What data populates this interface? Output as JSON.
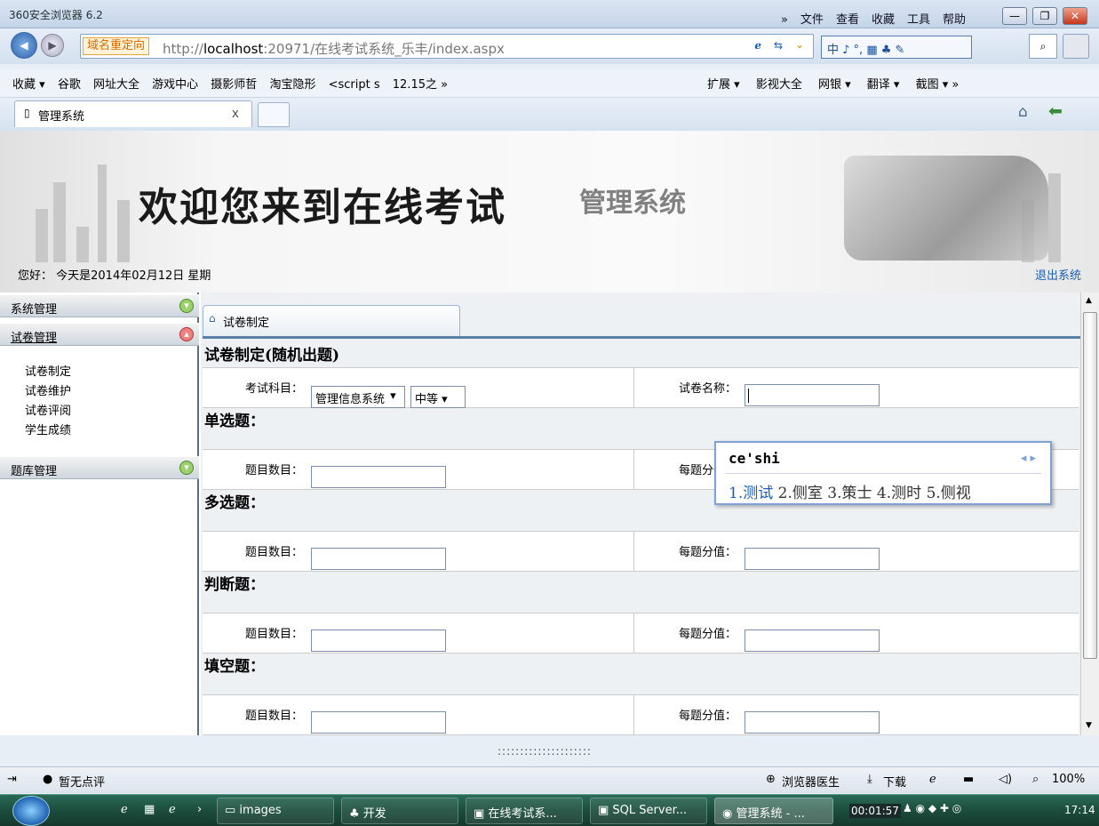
{
  "browser": {
    "title": "360安全浏览器 6.2",
    "menu": [
      "»",
      "文件",
      "查看",
      "收藏",
      "工具",
      "帮助"
    ],
    "redirect_label": "域名重定向",
    "url_prefix": "http://",
    "url_host": "localhost",
    "url_rest": ":20971/在线考试系统_乐丰/index.aspx",
    "ime_bar_text": "中 ♪ °, ▦ ♣ ✎",
    "favorites": [
      "收藏 ▾",
      "谷歌",
      "网址大全",
      "游戏中心",
      "摄影师哲",
      "淘宝隐形",
      "<script s",
      "12.15之 »"
    ],
    "right_tools": [
      "扩展 ▾",
      "影视大全",
      "网银 ▾",
      "翻译 ▾",
      "截图 ▾ »"
    ],
    "tab_title": "管理系统",
    "tab_close": "x"
  },
  "banner": {
    "welcome": "欢迎您来到在线考试",
    "subtitle": "管理系统",
    "greeting": "您好：   今天是2014年02月12日   星期",
    "logout": "退出系统"
  },
  "sidebar": {
    "groups": [
      {
        "label": "系统管理"
      },
      {
        "label": "试卷管理"
      },
      {
        "label": "题库管理"
      }
    ],
    "items": [
      "试卷制定",
      "试卷维护",
      "试卷评阅",
      "学生成绩"
    ]
  },
  "main": {
    "tab_label": "试卷制定",
    "form_title": "试卷制定(随机出题)",
    "subject_label": "考试科目：",
    "subject_value": "管理信息系统",
    "level_value": "中等",
    "paper_name_label": "试卷名称：",
    "paper_name_value": "",
    "sections": [
      {
        "title": "单选题：",
        "count_label": "题目数目：",
        "score_label": "每题分值："
      },
      {
        "title": "多选题：",
        "count_label": "题目数目：",
        "score_label": "每题分值："
      },
      {
        "title": "判断题：",
        "count_label": "题目数目：",
        "score_label": "每题分值："
      },
      {
        "title": "填空题：",
        "count_label": "题目数目：",
        "score_label": "每题分值："
      }
    ]
  },
  "ime_popup": {
    "composition": "ce'shi",
    "arrows": "◂ ▸",
    "candidates": [
      "1.测试",
      "2.侧室",
      "3.策士",
      "4.测时",
      "5.侧视"
    ]
  },
  "status": {
    "dots": ":::::::::::::::::::::",
    "rating": "暂无点评",
    "doctor": "浏览器医生",
    "download": "下载",
    "zoom": "100%"
  },
  "taskbar": {
    "items": [
      "images",
      "开发",
      "在线考试系...",
      "SQL Server...",
      "管理系统 - ..."
    ],
    "timer": "00:01:57",
    "clock": "17:14"
  }
}
